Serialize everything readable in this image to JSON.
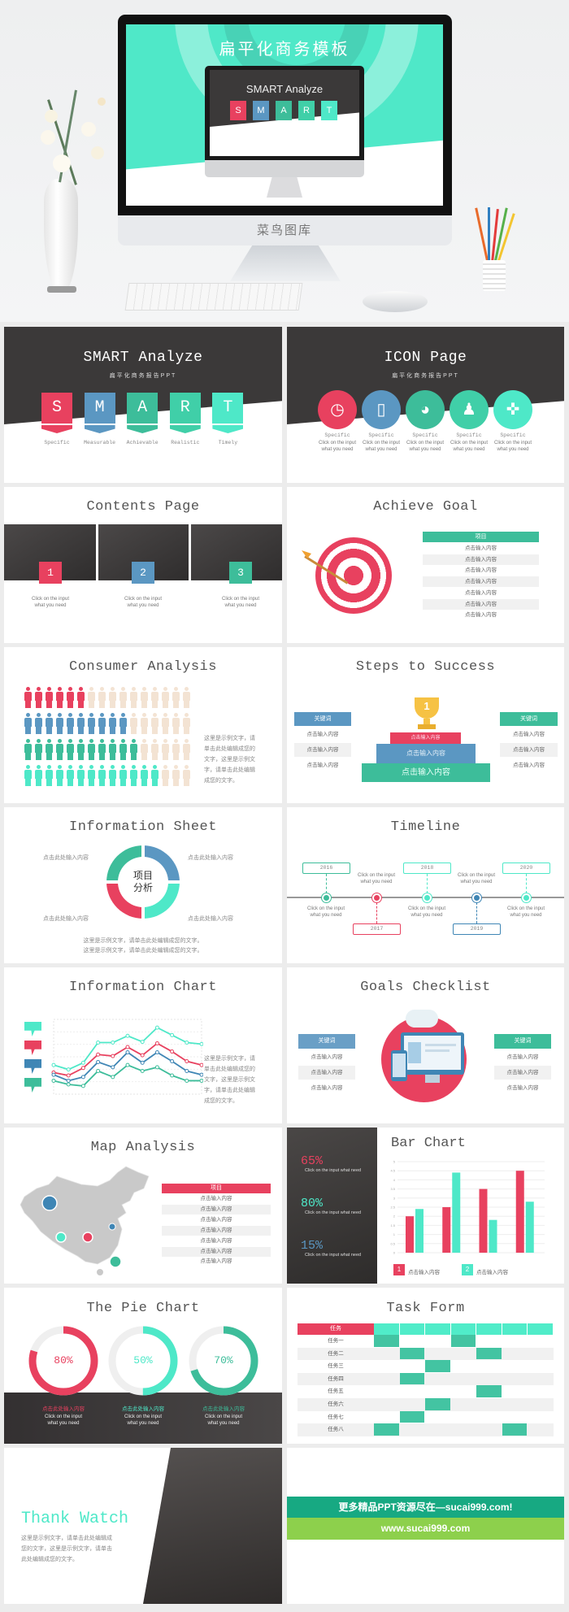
{
  "hero": {
    "screen_title": "扁平化商务模板",
    "inner_title": "SMART Analyze",
    "inner_letters": [
      "S",
      "M",
      "A",
      "R",
      "T"
    ],
    "brand": "菜鸟图库"
  },
  "colors": {
    "red": "#e8415f",
    "blue": "#5b97c2",
    "green": "#3dbd9a",
    "teal": "#4ee8c8",
    "mint": "#40cfa8",
    "dark": "#3b3939",
    "ad_green": "#17a982",
    "ad_lime": "#8dd04c"
  },
  "slides": {
    "smart": {
      "title": "SMART Analyze",
      "subtitle": "扁平化商务报告PPT",
      "letters": [
        "S",
        "M",
        "A",
        "R",
        "T"
      ],
      "labels": [
        "Specific",
        "Measurable",
        "Achievable",
        "Realistic",
        "Timely"
      ]
    },
    "icon_page": {
      "title": "ICON Page",
      "subtitle": "扁平化商务报告PPT",
      "items": [
        {
          "icon": "clock-icon",
          "label": "Specific",
          "line1": "Click on the input",
          "line2": "what you need"
        },
        {
          "icon": "phone-icon",
          "label": "Specific",
          "line1": "Click on the input",
          "line2": "what you need"
        },
        {
          "icon": "pie-icon",
          "label": "Specific",
          "line1": "Click on the input",
          "line2": "what you need"
        },
        {
          "icon": "users-icon",
          "label": "Specific",
          "line1": "Click on the input",
          "line2": "what you need"
        },
        {
          "icon": "gamepad-icon",
          "label": "Specific",
          "line1": "Click on the input",
          "line2": "what you need"
        }
      ]
    },
    "contents": {
      "title": "Contents Page",
      "items": [
        {
          "num": "1",
          "line1": "Click on the input",
          "line2": "what you need"
        },
        {
          "num": "2",
          "line1": "Click on the input",
          "line2": "what you need"
        },
        {
          "num": "3",
          "line1": "Click on the input",
          "line2": "what you need"
        }
      ]
    },
    "achieve": {
      "title": "Achieve Goal",
      "header": "项目",
      "rows": [
        "点击输入内容",
        "点击输入内容",
        "点击输入内容",
        "点击输入内容",
        "点击输入内容",
        "点击输入内容",
        "点击输入内容"
      ]
    },
    "consumer": {
      "title": "Consumer Analysis",
      "per_row": 16,
      "rows": [
        6,
        10,
        11,
        13
      ],
      "text": [
        "这里是示例文字，请",
        "单击此处编辑成您的",
        "文字，这里是示例文",
        "字，请单击此处编辑",
        "成您的文字。"
      ]
    },
    "steps": {
      "title": "Steps to Success",
      "left": {
        "header": "关键词",
        "rows": [
          "点击输入内容",
          "点击输入内容",
          "点击输入内容"
        ]
      },
      "right": {
        "header": "关键词",
        "rows": [
          "点击输入内容",
          "点击输入内容",
          "点击输入内容"
        ]
      },
      "trophy": "1",
      "podium": [
        "点击输入内容",
        "点击输入内容",
        "点击输入内容"
      ]
    },
    "info_sheet": {
      "title": "Information Sheet",
      "center": [
        "项目",
        "分析"
      ],
      "labels": [
        "点击此处输入内容",
        "点击此处输入内容",
        "点击此处输入内容",
        "点击此处输入内容"
      ],
      "bottom": [
        "这里是示例文字，请单击此处编辑成您的文字。",
        "这里是示例文字，请单击此处编辑成您的文字。"
      ]
    },
    "timeline": {
      "title": "Timeline",
      "events": [
        {
          "year": "2016",
          "line1": "Click on the input",
          "line2": "what you need"
        },
        {
          "year": "2017",
          "line1": "Click on the input",
          "line2": "what you need"
        },
        {
          "year": "2018",
          "line1": "Click on the input",
          "line2": "what you need"
        },
        {
          "year": "2019",
          "line1": "Click on the input",
          "line2": "what you need"
        },
        {
          "year": "2020",
          "line1": "Click on the input",
          "line2": "what you need"
        }
      ]
    },
    "info_chart": {
      "title": "Information Chart",
      "text": [
        "这里是示例文字，请",
        "单击此处编辑成您的",
        "文字，这里是示例文",
        "字，请单击此处编辑",
        "成您的文字。"
      ],
      "series": [
        {
          "color": "#4ee8c8",
          "values": [
            39,
            33,
            42,
            69,
            69,
            78,
            70,
            89,
            79,
            69,
            67
          ]
        },
        {
          "color": "#e8415f",
          "values": [
            29,
            25,
            35,
            53,
            51,
            63,
            52,
            68,
            57,
            44,
            39
          ]
        },
        {
          "color": "#3f86b5",
          "values": [
            26,
            18,
            23,
            43,
            36,
            56,
            42,
            56,
            44,
            31,
            26
          ]
        },
        {
          "color": "#3dbd9a",
          "values": [
            18,
            13,
            11,
            31,
            23,
            39,
            31,
            36,
            25,
            18,
            18
          ]
        }
      ]
    },
    "goals": {
      "title": "Goals Checklist",
      "left": {
        "header": "关键词",
        "rows": [
          "点击输入内容",
          "点击输入内容",
          "点击输入内容"
        ]
      },
      "right": {
        "header": "关键词",
        "rows": [
          "点击输入内容",
          "点击输入内容",
          "点击输入内容"
        ]
      }
    },
    "map": {
      "title": "Map Analysis",
      "header": "项目",
      "rows": [
        "点击输入内容",
        "点击输入内容",
        "点击输入内容",
        "点击输入内容",
        "点击输入内容",
        "点击输入内容",
        "点击输入内容"
      ]
    },
    "bar": {
      "title": "Bar Chart",
      "stats": [
        {
          "value": "65%",
          "text": "Click on the input what need",
          "color": "#e8415f"
        },
        {
          "value": "80%",
          "text": "Click on the input what need",
          "color": "#4ee8c8"
        },
        {
          "value": "15%",
          "text": "Click on the input what need",
          "color": "#5b97c2"
        }
      ],
      "chart_data": {
        "type": "bar",
        "categories": [
          "1",
          "2",
          "3",
          "4"
        ],
        "ylim": [
          0,
          5
        ],
        "yticks": [
          "0",
          "0.5",
          "1",
          "1.5",
          "2",
          "2.5",
          "3",
          "3.5",
          "4",
          "4.5",
          "5"
        ],
        "series": [
          {
            "color": "#e8415f",
            "values": [
              2,
              2.5,
              3.5,
              4.5
            ]
          },
          {
            "color": "#4ee8c8",
            "values": [
              2.4,
              4.4,
              1.8,
              2.8
            ]
          }
        ]
      },
      "legend": [
        {
          "num": "1",
          "label": "点击输入内容"
        },
        {
          "num": "2",
          "label": "点击输入内容"
        }
      ]
    },
    "pie": {
      "title": "The Pie Chart",
      "rings": [
        {
          "percent": 80,
          "label": "80%",
          "color": "#e8415f",
          "caption": "点击此处输入内容",
          "line1": "Click on the input",
          "line2": "what you need"
        },
        {
          "percent": 50,
          "label": "50%",
          "color": "#4ee8c8",
          "caption": "点击此处输入内容",
          "line1": "Click on the input",
          "line2": "what you need"
        },
        {
          "percent": 70,
          "label": "70%",
          "color": "#3dbd9a",
          "caption": "点击此处输入内容",
          "line1": "Click on the input",
          "line2": "what you need"
        }
      ]
    },
    "task": {
      "title": "Task Form",
      "header": "任务",
      "columns": 7,
      "rows": [
        {
          "name": "任务一",
          "cells": [
            0,
            3
          ]
        },
        {
          "name": "任务二",
          "cells": [
            1,
            4
          ]
        },
        {
          "name": "任务三",
          "cells": [
            2
          ]
        },
        {
          "name": "任务四",
          "cells": [
            1
          ]
        },
        {
          "name": "任务五",
          "cells": [
            4
          ]
        },
        {
          "name": "任务六",
          "cells": [
            2
          ]
        },
        {
          "name": "任务七",
          "cells": [
            1
          ]
        },
        {
          "name": "任务八",
          "cells": [
            0,
            5
          ]
        }
      ]
    },
    "thanks": {
      "title": "Thank Watch",
      "text": [
        "这里是示例文字，请单击此处编辑成",
        "您的文字，这里是示例文字，请单击",
        "此处编辑成您的文字。"
      ]
    },
    "ad": {
      "line1": "更多精品PPT资源尽在—sucai999.com!",
      "line2": "www.sucai999.com"
    }
  }
}
